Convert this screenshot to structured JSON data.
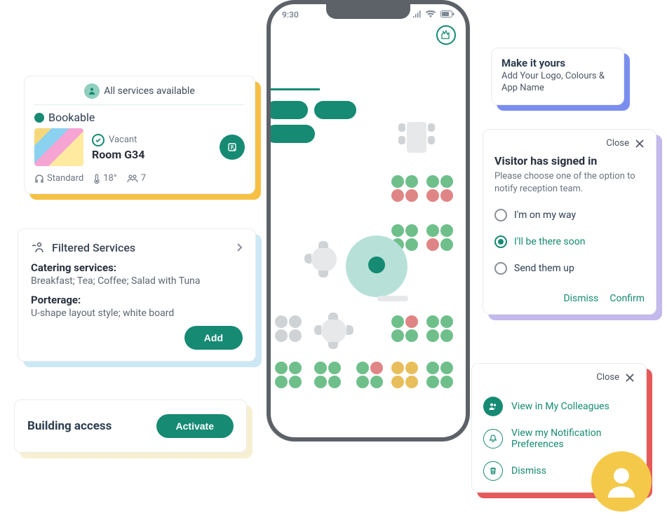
{
  "phone": {
    "time": "9:30"
  },
  "services": {
    "header": "All services available",
    "legend_bookable": "Bookable",
    "status_vacant": "Vacant",
    "room_name": "Room G34",
    "meta_standard": "Standard",
    "meta_temp": "18°",
    "meta_capacity": "7"
  },
  "filtered": {
    "title": "Filtered Services",
    "catering_label": "Catering services:",
    "catering_body": "Breakfast; Tea; Coffee; Salad with Tuna",
    "porterage_label": "Porterage:",
    "porterage_body": "U-shape layout style; white board",
    "add": "Add"
  },
  "building": {
    "title": "Building access",
    "activate": "Activate"
  },
  "make_it_yours": {
    "title": "Make it yours",
    "sub": "Add Your Logo, Colours & App Name"
  },
  "visitor": {
    "close": "Close",
    "title": "Visitor has signed in",
    "sub": "Please choose one of the option to notify reception team.",
    "options": [
      "I'm on my way",
      "I'll be there soon",
      "Send them up"
    ],
    "dismiss": "Dismiss",
    "confirm": "Confirm"
  },
  "notif": {
    "close": "Close",
    "view_colleagues": "View in My Colleagues",
    "view_prefs": "View my Notification Preferences",
    "dismiss": "Dismiss"
  }
}
